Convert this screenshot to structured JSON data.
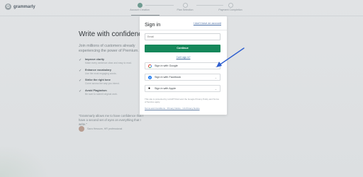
{
  "app": {
    "logo_text": "grammarly",
    "logo_glyph": "G"
  },
  "steps": [
    {
      "label": "Account Creation",
      "active": true
    },
    {
      "label": "Plan Selection",
      "active": false
    },
    {
      "label": "Payment Completion",
      "active": false
    }
  ],
  "left": {
    "headline": "Write with confidence",
    "subtitle": "Join millions of customers already experiencing the power of Premium.",
    "features": [
      {
        "title": "Improve clarity",
        "desc": "Make every sentence clear and easy to read."
      },
      {
        "title": "Enhance vocabulary",
        "desc": "Use the most engaging words."
      },
      {
        "title": "Strike the right tone",
        "desc": "Come across the way you intend."
      },
      {
        "title": "Avoid Plagiarism",
        "desc": "Be sure to submit original work."
      }
    ],
    "quote": "\"Grammarly allows me to have confidence that I have a second set of eyes on everything that I write.\"",
    "quote_author": "Sara Hessom, HR professional"
  },
  "modal": {
    "title": "Sign in",
    "no_account_link": "I don't have an account",
    "email_placeholder": "Email",
    "continue_label": "Continue",
    "forgot_label": "Can't sign in?",
    "social": [
      {
        "label": "Sign in with Google",
        "icon": "google-icon"
      },
      {
        "label": "Sign in with Facebook",
        "icon": "facebook-icon"
      },
      {
        "label": "Sign in with Apple",
        "icon": "apple-icon"
      }
    ],
    "legal_text": "This site is protected by reCAPTCHA and the Google Privacy Policy and Terms of Service apply.",
    "legal_links": "Terms and Conditions · Privacy Notice · CA Privacy Notice"
  },
  "colors": {
    "continue": "#15875a",
    "link": "#4a6fa5",
    "annotation_arrow": "#2f5fd0"
  }
}
